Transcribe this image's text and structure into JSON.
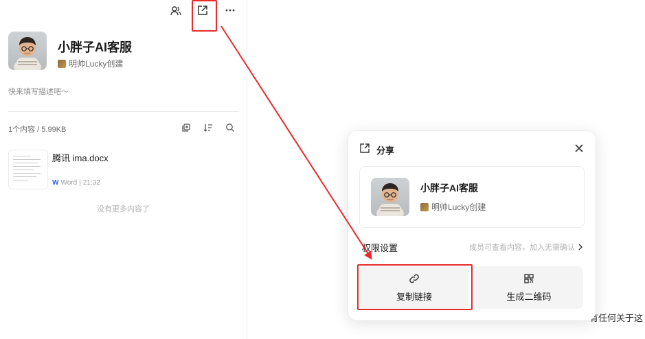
{
  "knowledge_base": {
    "title": "小胖子AI客服",
    "creator": "明帅Lucky创建",
    "description": "快来填写描述吧～",
    "stats": "1个内容 / 5.99KB",
    "empty_hint": "没有更多内容了"
  },
  "files": [
    {
      "name": "腾讯 ima.docx",
      "type": "Word",
      "time": "21:32"
    }
  ],
  "background_text": "有任何关于这",
  "share_dialog": {
    "title": "分享",
    "card_title": "小胖子AI客服",
    "card_creator": "明帅Lucky创建",
    "permission_label": "权限设置",
    "permission_value": "成员可查看内容，加入无需确认",
    "copy_link_label": "复制链接",
    "qr_label": "生成二维码"
  },
  "icons": {
    "members": "members-icon",
    "share": "share-icon",
    "more": "more-icon",
    "add": "add-content-icon",
    "sort": "sort-icon",
    "search": "search-icon",
    "link": "link-icon",
    "qr": "qr-code-icon",
    "close": "close-icon"
  },
  "colors": {
    "annotation": "#e82a2a",
    "word_blue": "#2b5fd9",
    "button_bg": "#f4f4f5"
  }
}
